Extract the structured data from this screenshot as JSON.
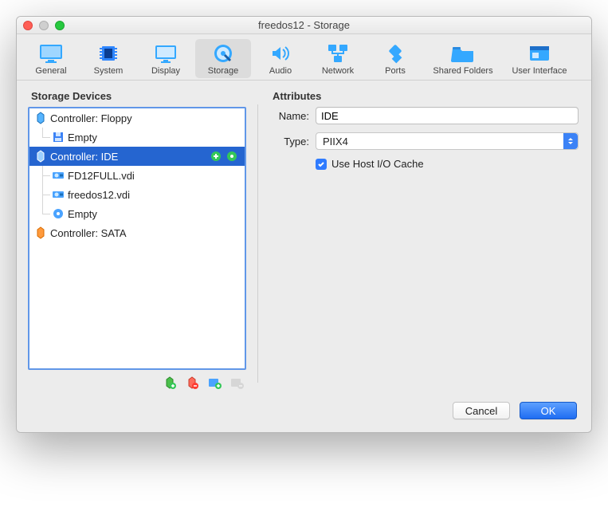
{
  "window": {
    "title": "freedos12 - Storage"
  },
  "toolbar": {
    "items": [
      {
        "id": "general",
        "label": "General",
        "active": false
      },
      {
        "id": "system",
        "label": "System",
        "active": false
      },
      {
        "id": "display",
        "label": "Display",
        "active": false
      },
      {
        "id": "storage",
        "label": "Storage",
        "active": true
      },
      {
        "id": "audio",
        "label": "Audio",
        "active": false
      },
      {
        "id": "network",
        "label": "Network",
        "active": false
      },
      {
        "id": "ports",
        "label": "Ports",
        "active": false
      },
      {
        "id": "shared",
        "label": "Shared Folders",
        "active": false
      },
      {
        "id": "ui",
        "label": "User Interface",
        "active": false
      }
    ]
  },
  "sections": {
    "devices_label": "Storage Devices",
    "attributes_label": "Attributes"
  },
  "tree": {
    "floppy_controller": "Controller: Floppy",
    "floppy_empty": "Empty",
    "ide_controller": "Controller: IDE",
    "ide_disk1": "FD12FULL.vdi",
    "ide_disk2": "freedos12.vdi",
    "ide_empty": "Empty",
    "sata_controller": "Controller: SATA"
  },
  "attributes": {
    "name_label": "Name:",
    "name_value": "IDE",
    "type_label": "Type:",
    "type_value": "PIIX4",
    "host_io_label": "Use Host I/O Cache",
    "host_io_checked": true
  },
  "buttons": {
    "cancel": "Cancel",
    "ok": "OK"
  }
}
